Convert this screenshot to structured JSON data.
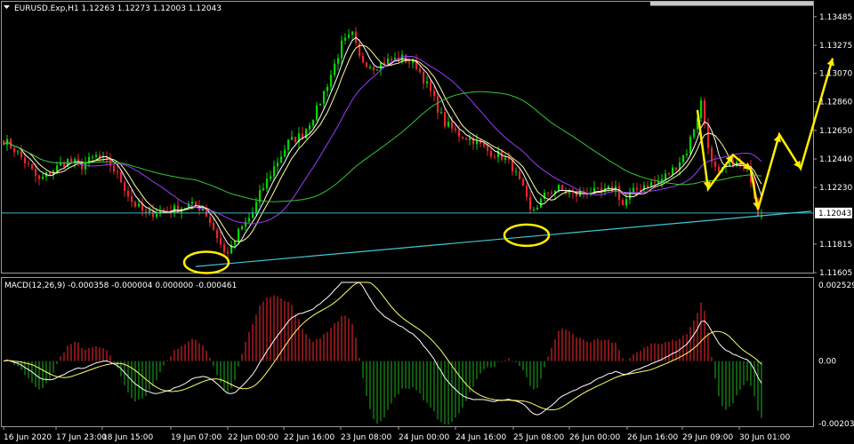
{
  "chart_data": [
    {
      "type": "candlestick",
      "title": "EURUSD.Exp,H1  1.12263 1.12273 1.12003 1.12043",
      "ylim": [
        1.11605,
        1.13595
      ],
      "yticks": [
        "1.13485",
        "1.13275",
        "1.13070",
        "1.12860",
        "1.12650",
        "1.12440",
        "1.12230",
        "1.12043",
        "1.11815",
        "1.11605"
      ],
      "current_price": "1.12043",
      "price_path": [
        [
          0,
          1.1258
        ],
        [
          3,
          1.1251
        ],
        [
          6,
          1.1242
        ],
        [
          10,
          1.1228
        ],
        [
          14,
          1.1236
        ],
        [
          18,
          1.1243
        ],
        [
          22,
          1.1239
        ],
        [
          26,
          1.1246
        ],
        [
          30,
          1.124
        ],
        [
          33,
          1.1228
        ],
        [
          36,
          1.1213
        ],
        [
          40,
          1.1203
        ],
        [
          44,
          1.1206
        ],
        [
          48,
          1.1207
        ],
        [
          52,
          1.121
        ],
        [
          56,
          1.1208
        ],
        [
          58,
          1.1198
        ],
        [
          60,
          1.1187
        ],
        [
          62,
          1.1175
        ],
        [
          64,
          1.1178
        ],
        [
          66,
          1.119
        ],
        [
          70,
          1.1204
        ],
        [
          72,
          1.1218
        ],
        [
          76,
          1.1238
        ],
        [
          80,
          1.1256
        ],
        [
          84,
          1.1262
        ],
        [
          88,
          1.128
        ],
        [
          92,
          1.1306
        ],
        [
          95,
          1.1328
        ],
        [
          98,
          1.1335
        ],
        [
          100,
          1.1318
        ],
        [
          104,
          1.1312
        ],
        [
          108,
          1.1316
        ],
        [
          112,
          1.1318
        ],
        [
          116,
          1.1313
        ],
        [
          120,
          1.1293
        ],
        [
          124,
          1.127
        ],
        [
          128,
          1.1262
        ],
        [
          132,
          1.1258
        ],
        [
          136,
          1.125
        ],
        [
          140,
          1.1246
        ],
        [
          143,
          1.1238
        ],
        [
          146,
          1.1221
        ],
        [
          148,
          1.1205
        ],
        [
          150,
          1.121
        ],
        [
          153,
          1.122
        ],
        [
          156,
          1.1222
        ],
        [
          160,
          1.1217
        ],
        [
          164,
          1.122
        ],
        [
          168,
          1.1219
        ],
        [
          172,
          1.1223
        ],
        [
          174,
          1.121
        ],
        [
          176,
          1.1218
        ],
        [
          180,
          1.1225
        ],
        [
          184,
          1.1227
        ],
        [
          188,
          1.1236
        ],
        [
          192,
          1.125
        ],
        [
          195,
          1.1276
        ],
        [
          196,
          1.1286
        ],
        [
          197,
          1.127
        ],
        [
          199,
          1.124
        ],
        [
          201,
          1.1232
        ],
        [
          203,
          1.1238
        ],
        [
          205,
          1.1242
        ],
        [
          207,
          1.1238
        ],
        [
          209,
          1.1236
        ],
        [
          210,
          1.123
        ],
        [
          212,
          1.1205
        ]
      ],
      "support_line": [
        [
          54,
          1.1165
        ],
        [
          212,
          1.1203
        ]
      ],
      "horizontal_level": 1.12043,
      "ellipses": [
        [
          57,
          1.1168
        ],
        [
          147,
          1.1188
        ]
      ],
      "forecast_arrows": [
        [
          [
            195,
            1.128
          ],
          [
            198,
            1.1222
          ],
          [
            205,
            1.1247
          ],
          [
            210,
            1.1236
          ],
          [
            212,
            1.1207
          ],
          [
            218,
            1.1262
          ],
          [
            224,
            1.1237
          ],
          [
            233,
            1.1318
          ]
        ]
      ]
    },
    {
      "type": "macd",
      "title": "MACD(12,26,9) -0.000358 -0.000004 0.000000 -0.000461",
      "ylim": [
        -0.00203,
        0.00252
      ],
      "yticks": [
        "0.002529",
        "0.00",
        "-0.00203"
      ],
      "x_labels": [
        "16 Jun 2020",
        "17 Jun 23:00",
        "18 Jun 15:00",
        "19 Jun 07:00",
        "22 Jun 00:00",
        "22 Jun 16:00",
        "23 Jun 08:00",
        "24 Jun 00:00",
        "24 Jun 16:00",
        "25 Jun 08:00",
        "26 Jun 00:00",
        "26 Jun 16:00",
        "29 Jun 09:00",
        "30 Jun 01:00"
      ]
    }
  ]
}
